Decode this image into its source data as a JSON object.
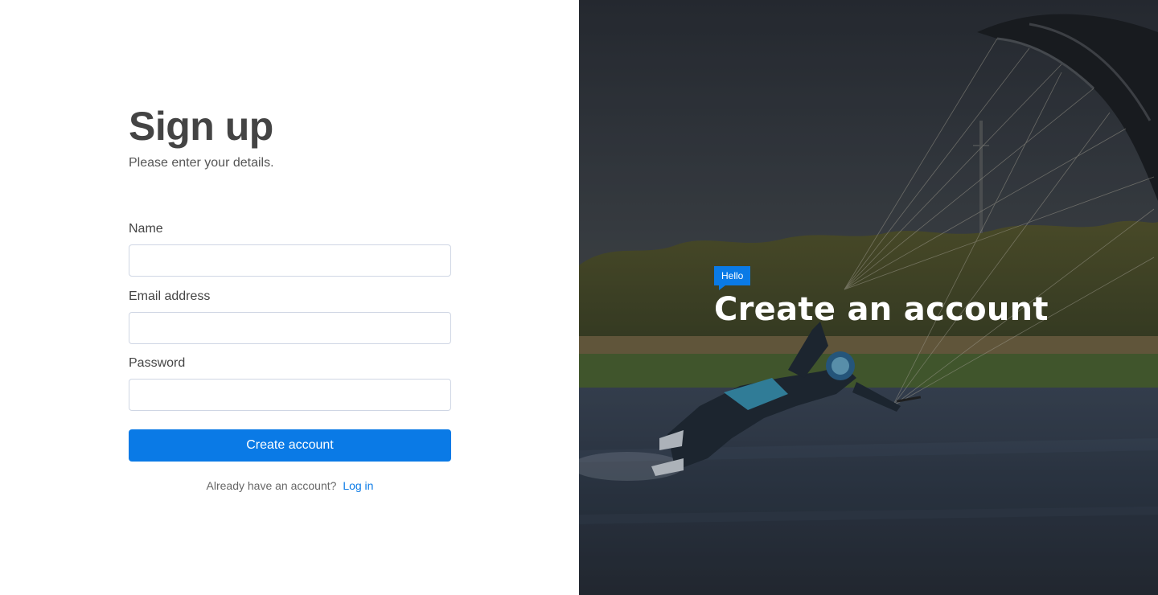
{
  "form": {
    "title": "Sign up",
    "subtitle": "Please enter your details.",
    "fields": {
      "name": {
        "label": "Name",
        "value": "",
        "placeholder": ""
      },
      "email": {
        "label": "Email address",
        "value": "",
        "placeholder": ""
      },
      "password": {
        "label": "Password",
        "value": "",
        "placeholder": ""
      }
    },
    "submit_label": "Create account",
    "login_prompt": "Already have an account?",
    "login_link": "Log in"
  },
  "hero": {
    "badge": "Hello",
    "title": "Create an account"
  },
  "colors": {
    "accent": "#0a7ae6",
    "heading": "#444444",
    "input_border": "#cfd6e4"
  }
}
